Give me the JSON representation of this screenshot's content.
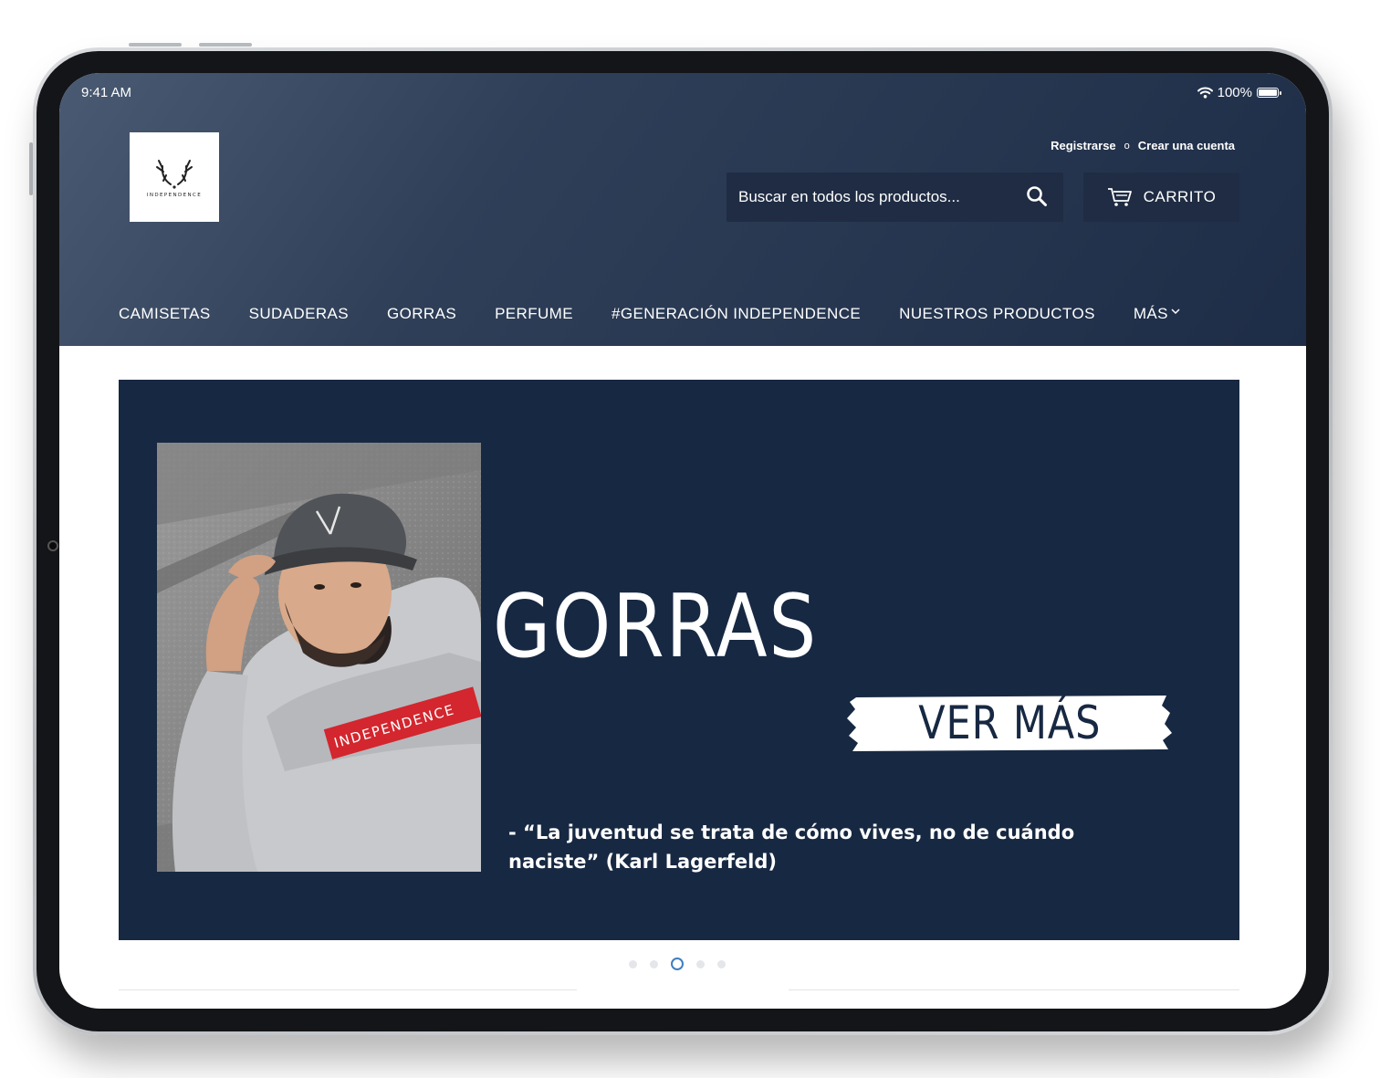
{
  "status_bar": {
    "time": "9:41 AM",
    "battery": "100%",
    "battery_level": 1.0
  },
  "brand": {
    "logo_text": "INDEPENDENCE",
    "header_color": "#2a3a54",
    "banner_color": "#172842",
    "accent_dot_color": "#3f7fc0"
  },
  "account": {
    "login": "Registrarse",
    "separator": "o",
    "create": "Crear una cuenta"
  },
  "search": {
    "placeholder": "Buscar en todos los productos..."
  },
  "cart": {
    "label": "CARRITO"
  },
  "nav": {
    "items": [
      {
        "label": "CAMISETAS"
      },
      {
        "label": "SUDADERAS"
      },
      {
        "label": "GORRAS"
      },
      {
        "label": "PERFUME"
      },
      {
        "label": "#GENERACIÓN INDEPENDENCE"
      },
      {
        "label": "NUESTROS PRODUCTOS"
      },
      {
        "label": "MÁS"
      }
    ]
  },
  "hero": {
    "title": "GORRAS",
    "cta": "VER MÁS",
    "quote": "- “La juventud se trata de cómo vives, no de cuándo naciste” (Karl Lagerfeld)",
    "hoodie_print": "INDEPENDENCE"
  },
  "carousel": {
    "slide_count": 5,
    "active_index": 2
  },
  "icons": [
    "wifi-icon",
    "battery-icon",
    "deer-antlers-logo-icon",
    "search-icon",
    "cart-icon",
    "chevron-down-icon"
  ]
}
